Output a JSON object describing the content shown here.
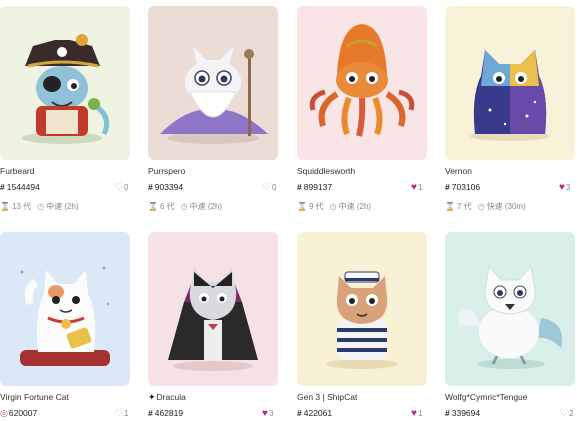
{
  "cards": [
    {
      "name": "Furbeard",
      "id": "1544494",
      "likes": "0",
      "liked": false,
      "gen": "13 代",
      "speed": "中速 (2h)",
      "bg": "#eef3e2"
    },
    {
      "name": "Purrspero",
      "id": "903394",
      "likes": "0",
      "liked": false,
      "gen": "6 代",
      "speed": "中速 (2h)",
      "bg": "#ecdcd6"
    },
    {
      "name": "Squiddlesworth",
      "id": "899137",
      "likes": "1",
      "liked": true,
      "gen": "9 代",
      "speed": "中速 (2h)",
      "bg": "#f9e4e6"
    },
    {
      "name": "Vernon",
      "id": "703106",
      "likes": "3",
      "liked": true,
      "gen": "7 代",
      "speed": "快速 (30m)",
      "bg": "#f8f2d8"
    },
    {
      "name": "Virgin Fortune Cat",
      "id": "620007",
      "likes": "1",
      "liked": false,
      "bg": "#dbe8f8"
    },
    {
      "name": "Dracula",
      "id": "462819",
      "likes": "3",
      "liked": true,
      "bg": "#f6e1e4"
    },
    {
      "name": "Gen 3 | ShipCat",
      "id": "422061",
      "likes": "1",
      "liked": true,
      "bg": "#f8f1d6"
    },
    {
      "name": "Wolfg*Cymric*Tengue",
      "id": "339694",
      "likes": "2",
      "liked": false,
      "bg": "#d9efe9"
    }
  ],
  "icons": {
    "hash": "#",
    "heart": "♡",
    "heart_filled": "♥",
    "hourglass": "⌛",
    "clock": "◷",
    "fortune_badge": "◎",
    "dracula_badge": "✦"
  },
  "colors": {
    "heart_liked": "#b22a8a",
    "text_muted": "#888888",
    "fortune_badge": "#c2447a"
  }
}
